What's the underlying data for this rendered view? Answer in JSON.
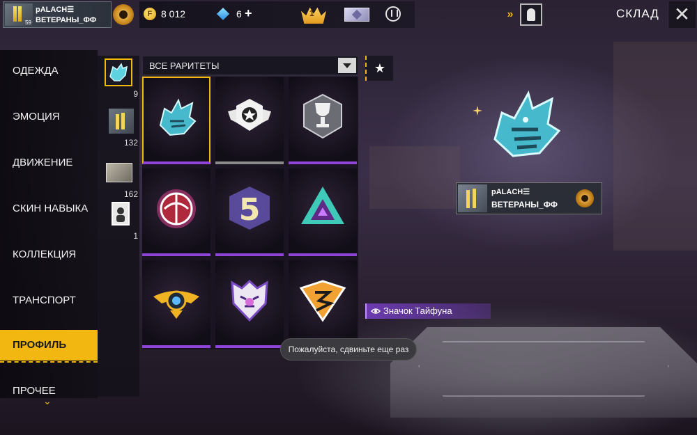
{
  "player": {
    "name": "pALACH☰",
    "guild": "ВЕТЕРАНЫ_ФФ",
    "level": "59"
  },
  "currency": {
    "coins": "8 012",
    "diamonds": "6",
    "diamonds_plus": "+"
  },
  "header": {
    "crown_number": "1",
    "title": "СКЛАД",
    "close_label": "✕",
    "arrows_label": "»"
  },
  "menu": {
    "items": [
      {
        "label": "ОДЕЖДА"
      },
      {
        "label": "ЭМОЦИЯ"
      },
      {
        "label": "ДВИЖЕНИЕ"
      },
      {
        "label": "СКИН НАВЫКА"
      },
      {
        "label": "КОЛЛЕКЦИЯ"
      },
      {
        "label": "ТРАНСПОРТ"
      },
      {
        "label": "ПРОФИЛЬ"
      },
      {
        "label": "ПРОЧЕЕ"
      }
    ],
    "active": "ПРОФИЛЬ",
    "more_icon": "chevron-down-icon"
  },
  "subcategories": [
    {
      "icon": "badge-icon",
      "count": "9"
    },
    {
      "icon": "avatar-icon",
      "count": "132"
    },
    {
      "icon": "banner-icon",
      "count": "162"
    },
    {
      "icon": "card-icon",
      "count": "1"
    }
  ],
  "filter": {
    "label": "ВСЕ РАРИТЕТЫ",
    "fav_icon": "★"
  },
  "grid_items": [
    {
      "icon": "wolf-badge-icon",
      "rarity": "purple"
    },
    {
      "icon": "winged-star-badge-icon",
      "rarity": "gray"
    },
    {
      "icon": "trophy-badge-icon",
      "rarity": "purple"
    },
    {
      "icon": "flaming-ball-badge-icon",
      "rarity": "purple"
    },
    {
      "icon": "number-five-badge-icon",
      "rarity": "purple"
    },
    {
      "icon": "triangle-badge-icon",
      "rarity": "purple"
    },
    {
      "icon": "winged-orb-badge-icon",
      "rarity": "purple"
    },
    {
      "icon": "tiger-badge-icon",
      "rarity": "purple"
    },
    {
      "icon": "chevron-s-badge-icon",
      "rarity": "purple"
    }
  ],
  "preview": {
    "name": "pALACH☰",
    "guild": "ВЕТЕРАНЫ_ФФ",
    "item_name": "Значок Тайфуна"
  },
  "toast": "Пожалуйста, сдвиньте еще раз",
  "colors": {
    "accent": "#f3b712",
    "rarity_purple": "#8e44d8",
    "rarity_gray": "#8a8a8a"
  }
}
